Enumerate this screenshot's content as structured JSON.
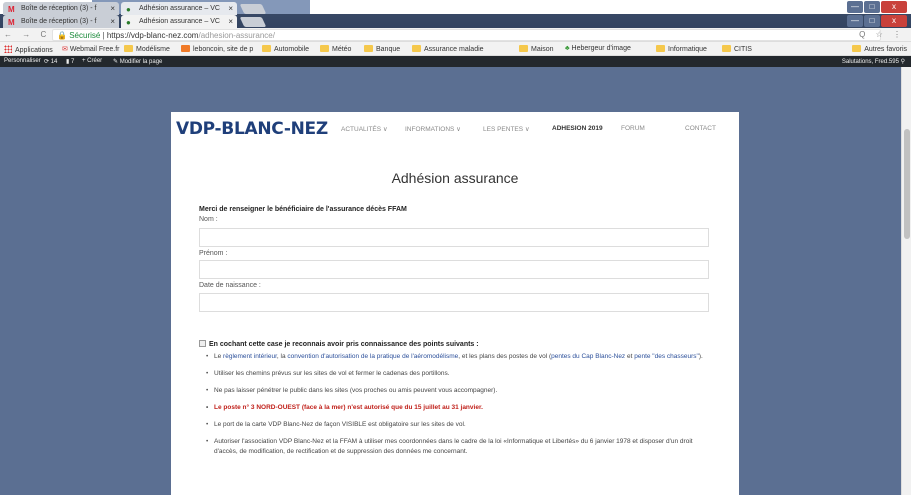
{
  "browser": {
    "tabs_back": [
      {
        "label": "Boîte de réception (3) - f",
        "icon": "gmail-icon"
      },
      {
        "label": "Adhésion assurance – VC",
        "icon": "globe-icon"
      }
    ],
    "tabs_front": [
      {
        "label": "Boîte de réception (3) - f",
        "icon": "gmail-icon"
      },
      {
        "label": "Adhésion assurance – VC",
        "icon": "globe-icon"
      }
    ],
    "window_buttons": {
      "minimize": "—",
      "maximize": "□",
      "close": "x"
    },
    "address": {
      "secure_label": "Sécurisé",
      "separator": " | ",
      "host": "https://vdp-blanc-nez.com",
      "path": "/adhesion-assurance/",
      "nav": "← → C",
      "right_icons": "Q ☆ ⋮"
    },
    "bookmarks": [
      "Applications",
      "Webmail Free.fr",
      "Modélisme",
      "leboncoin, site de p",
      "Automobile",
      "Météo",
      "Banque",
      "Assurance maladie",
      "Maison",
      "Hebergeur d'image",
      "Informatique",
      "CITIS"
    ],
    "bookmarks_right": "Autres favoris"
  },
  "wpbar": {
    "items": [
      "Personnaliser",
      "14",
      "7",
      "+ Créer",
      "Modifier la page"
    ],
    "greeting": "Salutations, Fred.595"
  },
  "site": {
    "logo": "VDP-BLANC-NEZ",
    "menu": [
      "ACTUALITÉS",
      "INFORMATIONS",
      "LES PENTES",
      "ADHESION 2019",
      "FORUM",
      "CONTACT"
    ],
    "menu_dropdown_marker": "∨"
  },
  "form": {
    "title": "Adhésion assurance",
    "intro": "Merci de renseigner le bénéficiaire de l'assurance décès FFAM",
    "fields": [
      {
        "label": "Nom :",
        "value": ""
      },
      {
        "label": "Prénom :",
        "value": ""
      },
      {
        "label": "Date de naissance :",
        "value": ""
      }
    ],
    "checkbox_label": "En cochant cette case je reconnais avoir pris connaissance des points suivants :",
    "checkbox_checked": false,
    "points": {
      "p1_a": "Le ",
      "p1_link1": "règlement intérieur",
      "p1_b": ", la ",
      "p1_link2": "convention d'autorisation de la pratique de l'aéromodélisme",
      "p1_c": ", et les plans des postes de vol (",
      "p1_link3": "pentes du Cap Blanc-Nez",
      "p1_d": " et ",
      "p1_link4": "pente \"des chasseurs\"",
      "p1_e": ").",
      "p2": "Utiliser les chemins prévus sur les sites de vol et fermer le cadenas des portillons.",
      "p3": "Ne pas laisser pénétrer le public dans les sites (vos proches ou amis peuvent vous accompagner).",
      "p4": "Le poste n° 3 NORD-OUEST (face à la mer) n'est autorisé que du 15 juillet au 31 janvier.",
      "p5": "Le port de la carte VDP Blanc-Nez de façon VISIBLE est obligatoire sur les sites de vol.",
      "p6": "Autoriser l'association VDP Blanc-Nez et la FFAM à utiliser mes coordonnées dans le cadre de la loi «Informatique et Libertés» du 6 janvier 1978 et disposer d'un droit d'accès, de modification, de rectification et de suppression des données me concernant."
    }
  },
  "colors": {
    "page_bg": "#5b6f92",
    "logo": "#1f3f7a",
    "warning": "#c0201a",
    "link": "#2b4f9a"
  }
}
